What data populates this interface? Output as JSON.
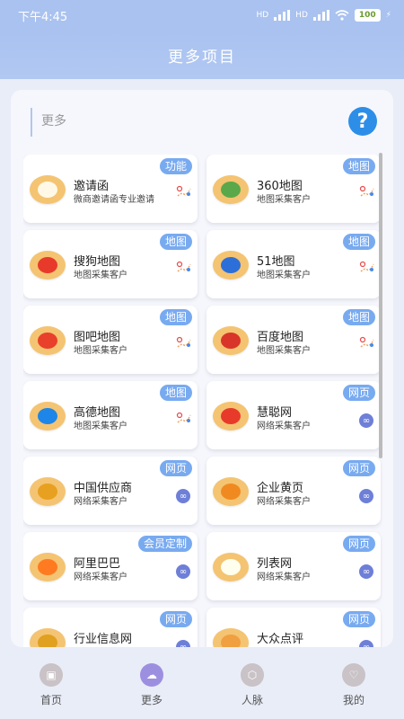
{
  "status": {
    "time": "下午4:45",
    "signal": "HD",
    "battery": "100"
  },
  "header": {
    "title": "更多项目"
  },
  "search": {
    "placeholder": "更多",
    "help_icon": "question-icon"
  },
  "colors": {
    "accent": "#a9c2f0",
    "tag": "#78aaf0",
    "link": "#6e7fd8"
  },
  "cards": [
    {
      "title": "邀请函",
      "subtitle": "微商邀请函专业邀请",
      "tag": "功能",
      "icon": "android-icon",
      "logo_color": "#f4c472",
      "action": "map-pin-icon"
    },
    {
      "title": "360地图",
      "subtitle": "地图采集客户",
      "tag": "地图",
      "icon": "360-map-icon",
      "logo_color": "#f4c472",
      "action": "map-pin-icon"
    },
    {
      "title": "搜狗地图",
      "subtitle": "地图采集客户",
      "tag": "地图",
      "icon": "sogou-map-icon",
      "logo_color": "#f4c472",
      "action": "map-pin-icon"
    },
    {
      "title": "51地图",
      "subtitle": "地图采集客户",
      "tag": "地图",
      "icon": "51-map-icon",
      "logo_color": "#f4c472",
      "action": "map-pin-icon"
    },
    {
      "title": "图吧地图",
      "subtitle": "地图采集客户",
      "tag": "地图",
      "icon": "tuba-map-icon",
      "logo_color": "#f4c472",
      "action": "map-pin-icon"
    },
    {
      "title": "百度地图",
      "subtitle": "地图采集客户",
      "tag": "地图",
      "icon": "baidu-map-icon",
      "logo_color": "#f4c472",
      "action": "map-pin-icon"
    },
    {
      "title": "高德地图",
      "subtitle": "地图采集客户",
      "tag": "地图",
      "icon": "gaode-map-icon",
      "logo_color": "#f4c472",
      "action": "map-pin-icon"
    },
    {
      "title": "慧聪网",
      "subtitle": "网络采集客户",
      "tag": "网页",
      "icon": "huicong-icon",
      "logo_color": "#f4c472",
      "action": "link-icon"
    },
    {
      "title": "中国供应商",
      "subtitle": "网络采集客户",
      "tag": "网页",
      "icon": "china-supplier-icon",
      "logo_color": "#f4c472",
      "action": "link-icon"
    },
    {
      "title": "企业黄页",
      "subtitle": "网络采集客户",
      "tag": "网页",
      "icon": "yellow-pages-icon",
      "logo_color": "#f4c472",
      "action": "link-icon"
    },
    {
      "title": "阿里巴巴",
      "subtitle": "网络采集客户",
      "tag": "会员定制",
      "icon": "alibaba-icon",
      "logo_color": "#f4c472",
      "action": "link-icon"
    },
    {
      "title": "列表网",
      "subtitle": "网络采集客户",
      "tag": "网页",
      "icon": "liebiao-icon",
      "logo_color": "#f4c472",
      "action": "link-icon"
    },
    {
      "title": "行业信息网",
      "subtitle": "",
      "tag": "网页",
      "icon": "industry-icon",
      "logo_color": "#f4c472",
      "action": "link-icon"
    },
    {
      "title": "大众点评",
      "subtitle": "",
      "tag": "网页",
      "icon": "dianping-icon",
      "logo_color": "#f4c472",
      "action": "link-icon"
    }
  ],
  "tabs": [
    {
      "label": "首页",
      "icon": "home-icon"
    },
    {
      "label": "更多",
      "icon": "more-icon"
    },
    {
      "label": "人脉",
      "icon": "contacts-icon"
    },
    {
      "label": "我的",
      "icon": "profile-icon"
    }
  ]
}
